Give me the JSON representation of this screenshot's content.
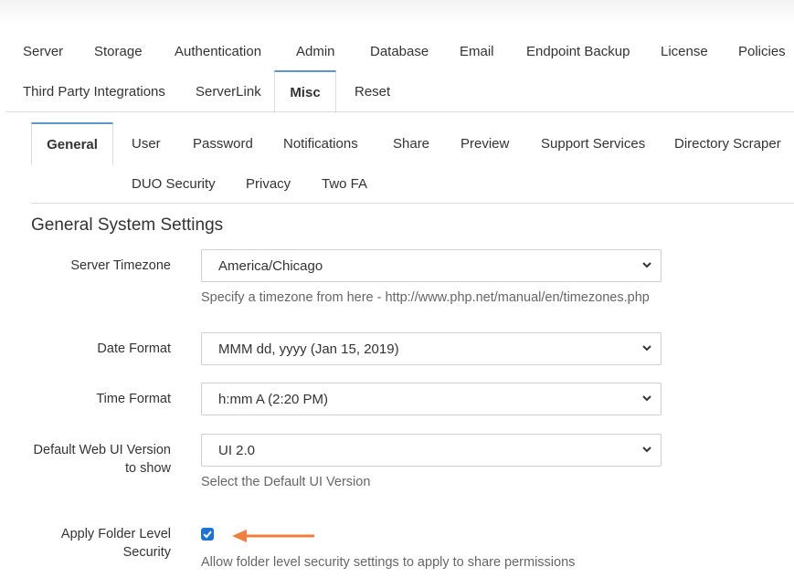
{
  "primary_tabs": [
    {
      "label": "Server"
    },
    {
      "label": "Storage"
    },
    {
      "label": "Authentication"
    },
    {
      "label": "Admin"
    },
    {
      "label": "Database"
    },
    {
      "label": "Email"
    },
    {
      "label": "Endpoint Backup"
    },
    {
      "label": "License"
    },
    {
      "label": "Policies"
    },
    {
      "label": "Third Party Integrations"
    },
    {
      "label": "ServerLink"
    },
    {
      "label": "Misc"
    },
    {
      "label": "Reset"
    }
  ],
  "primary_active": "Misc",
  "secondary_tabs": [
    {
      "label": "General"
    },
    {
      "label": "User"
    },
    {
      "label": "Password"
    },
    {
      "label": "Notifications"
    },
    {
      "label": "Share"
    },
    {
      "label": "Preview"
    },
    {
      "label": "Support Services"
    },
    {
      "label": "Directory Scraper"
    },
    {
      "label": "DUO Security"
    },
    {
      "label": "Privacy"
    },
    {
      "label": "Two FA"
    }
  ],
  "secondary_active": "General",
  "section_title": "General System Settings",
  "settings": {
    "timezone": {
      "label": "Server Timezone",
      "value": "America/Chicago",
      "help": "Specify a timezone from here - http://www.php.net/manual/en/timezones.php"
    },
    "date_format": {
      "label": "Date Format",
      "value": "MMM dd, yyyy (Jan 15, 2019)"
    },
    "time_format": {
      "label": "Time Format",
      "value": "h:mm A (2:20 PM)"
    },
    "web_ui_version": {
      "label_line1": "Default Web UI Version",
      "label_line2": "to show",
      "value": "UI 2.0",
      "help": "Select the Default UI Version"
    },
    "folder_security": {
      "label_line1": "Apply Folder Level",
      "label_line2": "Security",
      "checked": true,
      "help": "Allow folder level security settings to apply to share permissions"
    }
  },
  "colors": {
    "accent": "#5b97c9",
    "checkbox": "#1e73d2",
    "arrow": "#f07e3c"
  },
  "icons": {
    "select": "chevron-down-icon",
    "checkbox": "checkmark-icon",
    "annotation": "arrow-left-icon"
  }
}
